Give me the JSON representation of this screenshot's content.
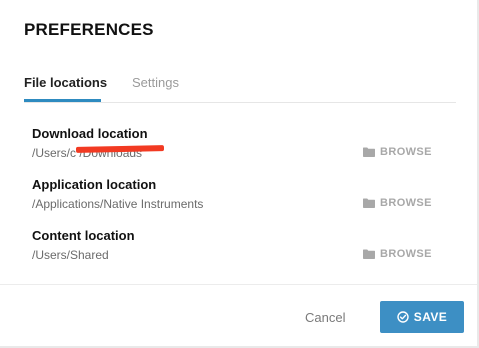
{
  "dialog": {
    "title": "PREFERENCES"
  },
  "tabs": [
    {
      "label": "File locations",
      "active": true
    },
    {
      "label": "Settings",
      "active": false
    }
  ],
  "locations": [
    {
      "label": "Download location",
      "path": "/Users/c                    /Downloads",
      "browse_label": "BROWSE",
      "icon": "folder-icon",
      "redacted": true
    },
    {
      "label": "Application location",
      "path": "/Applications/Native Instruments",
      "browse_label": "BROWSE",
      "icon": "folder-icon"
    },
    {
      "label": "Content location",
      "path": "/Users/Shared",
      "browse_label": "BROWSE",
      "icon": "folder-icon"
    }
  ],
  "footer": {
    "cancel_label": "Cancel",
    "save_label": "SAVE",
    "save_icon": "check-circle-icon"
  },
  "colors": {
    "accent": "#2e8bc0",
    "save_button": "#3d8fc4",
    "redaction": "#f23a22"
  }
}
